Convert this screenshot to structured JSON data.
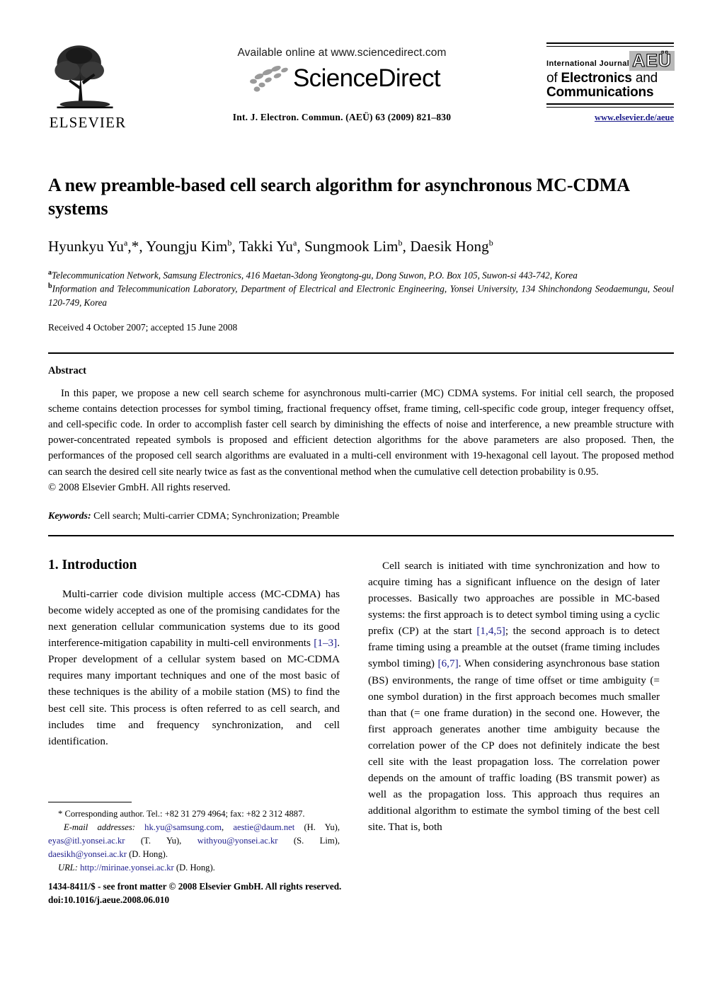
{
  "header": {
    "publisher_name": "ELSEVIER",
    "available_online": "Available online at www.sciencedirect.com",
    "sciencedirect_wordmark": "ScienceDirect",
    "journal_citation": "Int. J. Electron. Commun. (AEÜ) 63 (2009) 821–830",
    "journal_logo": {
      "line1_prefix": "International Journal",
      "badge": "AEÜ",
      "line2_light": "of",
      "line2_bold": "Electronics",
      "line2_tail": "and",
      "line3": "Communications"
    },
    "journal_url": "www.elsevier.de/aeue"
  },
  "article": {
    "title": "A new preamble-based cell search algorithm for asynchronous MC-CDMA systems",
    "authors": "Hyunkyu Yu<sup>a</sup>,*, Youngju Kim<sup>b</sup>, Takki Yu<sup>a</sup>, Sungmook Lim<sup>b</sup>, Daesik Hong<sup>b</sup>",
    "affiliation_a": "<sup>a</sup>Telecommunication Network, Samsung Electronics, 416 Maetan-3dong Yeongtong-gu, Dong Suwon, P.O. Box 105, Suwon-si 443-742, Korea",
    "affiliation_b": "<sup>b</sup>Information and Telecommunication Laboratory, Department of Electrical and Electronic Engineering, Yonsei University, 134 Shinchondong Seodaemungu, Seoul 120-749, Korea",
    "history": "Received 4 October 2007; accepted 15 June 2008"
  },
  "abstract": {
    "heading": "Abstract",
    "body": "In this paper, we propose a new cell search scheme for asynchronous multi-carrier (MC) CDMA systems. For initial cell search, the proposed scheme contains detection processes for symbol timing, fractional frequency offset, frame timing, cell-specific code group, integer frequency offset, and cell-specific code. In order to accomplish faster cell search by diminishing the effects of noise and interference, a new preamble structure with power-concentrated repeated symbols is proposed and efficient detection algorithms for the above parameters are also proposed. Then, the performances of the proposed cell search algorithms are evaluated in a multi-cell environment with 19-hexagonal cell layout. The proposed method can search the desired cell site nearly twice as fast as the conventional method when the cumulative cell detection probability is 0.95.",
    "copyright": "© 2008 Elsevier GmbH. All rights reserved.",
    "keywords_label": "Keywords:",
    "keywords_value": "Cell search; Multi-carrier CDMA; Synchronization; Preamble"
  },
  "sections": {
    "intro_heading": "1. Introduction",
    "left_paragraph_1": "Multi-carrier code division multiple access (MC-CDMA) has become widely accepted as one of the promising candidates for the next generation cellular communication systems due to its good interference-mitigation capability in multi-cell environments <span class=\"cite\">[1–3]</span>. Proper development of a cellular system based on MC-CDMA requires many important techniques and one of the most basic of these techniques is the ability of a mobile station (MS) to find the best cell site. This process is often referred to as cell search, and includes time and frequency synchronization, and cell identification.",
    "right_paragraph_1": "Cell search is initiated with time synchronization and how to acquire timing has a significant influence on the design of later processes. Basically two approaches are possible in MC-based systems: the first approach is to detect symbol timing using a cyclic prefix (CP) at the start <span class=\"cite\">[1,4,5]</span>; the second approach is to detect frame timing using a preamble at the outset (frame timing includes symbol timing) <span class=\"cite\">[6,7]</span>. When considering asynchronous base station (BS) environments, the range of time offset or time ambiguity (= one symbol duration) in the first approach becomes much smaller than that (= one frame duration) in the second one. However, the first approach generates another time ambiguity because the correlation power of the CP does not definitely indicate the best cell site with the least propagation loss. The correlation power depends on the amount of traffic loading (BS transmit power) as well as the propagation loss. This approach thus requires an additional algorithm to estimate the symbol timing of the best cell site. That is, both"
  },
  "footnotes": {
    "corresponding": "* Corresponding author. Tel.: +82 31 279 4964; fax: +82 2 312 4887.",
    "email_label": "E-mail addresses:",
    "emails": "<span class=\"fn-link\">hk.yu@samsung.com</span>, <span class=\"fn-link\">aestie@daum.net</span> (H. Yu), <span class=\"fn-link\">eyas@itl.yonsei.ac.kr</span> (T. Yu), <span class=\"fn-link\">withyou@yonsei.ac.kr</span> (S. Lim), <span class=\"fn-link\">daesikh@yonsei.ac.kr</span> (D. Hong).",
    "url_label": "URL:",
    "url_value": "http://mirinae.yonsei.ac.kr",
    "url_attrib": "(D. Hong)."
  },
  "footer": {
    "line1": "1434-8411/$ - see front matter © 2008 Elsevier GmbH. All rights reserved.",
    "line2": "doi:10.1016/j.aeue.2008.06.010"
  },
  "colors": {
    "link": "#1d1d8c",
    "text": "#000000",
    "badge_bg": "#b8b8b8"
  }
}
